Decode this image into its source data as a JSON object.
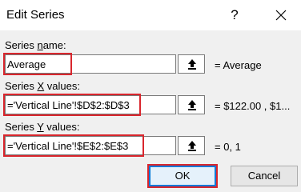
{
  "window": {
    "title": "Edit Series",
    "help_label": "?"
  },
  "series_name": {
    "label_pre": "Series ",
    "label_ul": "n",
    "label_post": "ame:",
    "value": "Average",
    "preview": "= Average"
  },
  "series_x": {
    "label_pre": "Series ",
    "label_ul": "X",
    "label_post": " values:",
    "value": "='Vertical Line'!$D$2:$D$3",
    "preview": "= $122.00 , $1..."
  },
  "series_y": {
    "label_pre": "Series ",
    "label_ul": "Y",
    "label_post": " values:",
    "value": "='Vertical Line'!$E$2:$E$3",
    "preview": "= 0, 1"
  },
  "buttons": {
    "ok": "OK",
    "cancel": "Cancel"
  },
  "colors": {
    "highlight": "#d9262d",
    "default_button_border": "#0078d7"
  }
}
